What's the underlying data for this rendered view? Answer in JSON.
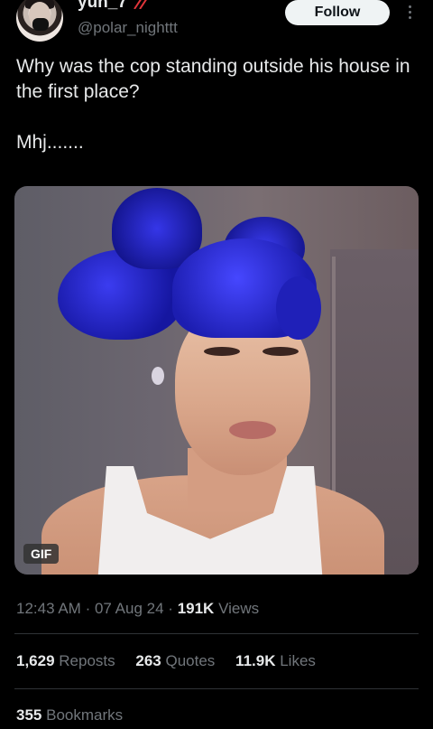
{
  "author": {
    "display_name": "yun_7",
    "handle": "@polar_nighttt",
    "avatar_icon": "avatar-photo"
  },
  "follow_label": "Follow",
  "tweet": {
    "text": "Why was the cop standing outside his house in the first place?\n\nMhj.......",
    "media_badge": "GIF"
  },
  "meta": {
    "time": "12:43 AM",
    "sep1": "·",
    "date": "07 Aug 24",
    "sep2": "·",
    "views_count": "191K",
    "views_label": "Views"
  },
  "stats": {
    "reposts_count": "1,629",
    "reposts_label": "Reposts",
    "quotes_count": "263",
    "quotes_label": "Quotes",
    "likes_count": "11.9K",
    "likes_label": "Likes",
    "bookmarks_count": "355",
    "bookmarks_label": "Bookmarks"
  },
  "colors": {
    "background": "#000000",
    "text_primary": "#e7e9ea",
    "text_secondary": "#71767b",
    "follow_bg": "#eff3f4",
    "divider": "#2f3336"
  }
}
